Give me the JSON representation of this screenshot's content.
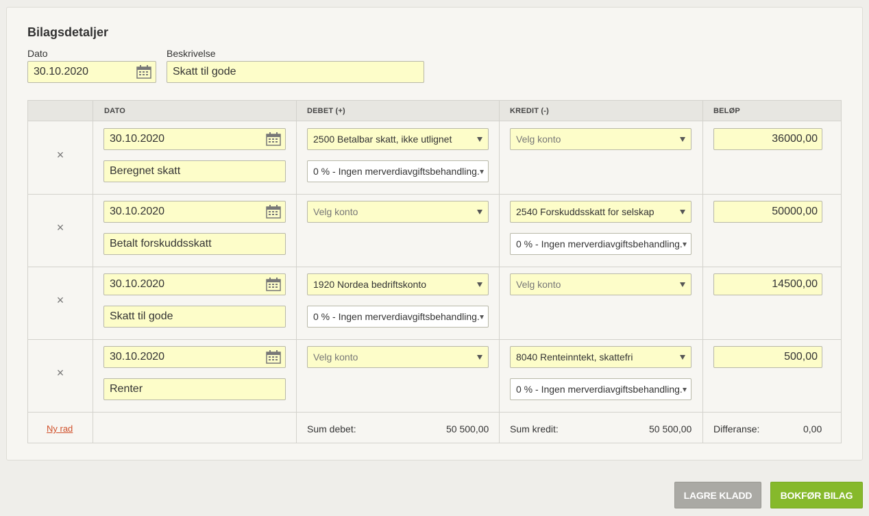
{
  "panel": {
    "title": "Bilagsdetaljer"
  },
  "header_fields": {
    "dato_label": "Dato",
    "dato_value": "30.10.2020",
    "beskrivelse_label": "Beskrivelse",
    "beskrivelse_value": "Skatt til gode"
  },
  "table": {
    "columns": [
      "DATO",
      "DEBET (+)",
      "KREDIT (-)",
      "BELØP"
    ],
    "delete_symbol": "×",
    "rows": [
      {
        "date": "30.10.2020",
        "description": "Beregnet skatt",
        "debet_account": "2500 Betalbar skatt, ikke utlignet",
        "debet_vat": "0 % - Ingen merverdiavgiftsbehandling.",
        "kredit_account": "Velg konto",
        "kredit_vat": "",
        "amount": "36000,00"
      },
      {
        "date": "30.10.2020",
        "description": "Betalt forskuddsskatt",
        "debet_account": "Velg konto",
        "debet_vat": "",
        "kredit_account": "2540 Forskuddsskatt for selskap",
        "kredit_vat": "0 % - Ingen merverdiavgiftsbehandling.",
        "amount": "50000,00"
      },
      {
        "date": "30.10.2020",
        "description": "Skatt til gode",
        "debet_account": "1920 Nordea bedriftskonto",
        "debet_vat": "0 % - Ingen merverdiavgiftsbehandling.",
        "kredit_account": "Velg konto",
        "kredit_vat": "",
        "amount": "14500,00"
      },
      {
        "date": "30.10.2020",
        "description": "Renter",
        "debet_account": "Velg konto",
        "debet_vat": "",
        "kredit_account": "8040 Renteinntekt, skattefri",
        "kredit_vat": "0 % - Ingen merverdiavgiftsbehandling.",
        "amount": "500,00"
      }
    ],
    "footer": {
      "new_row": "Ny rad",
      "sum_debet_label": "Sum debet:",
      "sum_debet_value": "50 500,00",
      "sum_kredit_label": "Sum kredit:",
      "sum_kredit_value": "50 500,00",
      "diff_label": "Differanse:",
      "diff_value": "0,00"
    }
  },
  "actions": {
    "save_draft": "LAGRE KLADD",
    "post": "BOKFØR BILAG"
  },
  "colors": {
    "field_bg": "#fdfdc9",
    "accent_red": "#d0502a",
    "btn_green": "#86b92b",
    "btn_gray": "#aaa9a4"
  },
  "icons": {
    "calendar": "calendar-icon",
    "delete": "delete-row-icon",
    "dropdown": "chevron-down-icon"
  }
}
